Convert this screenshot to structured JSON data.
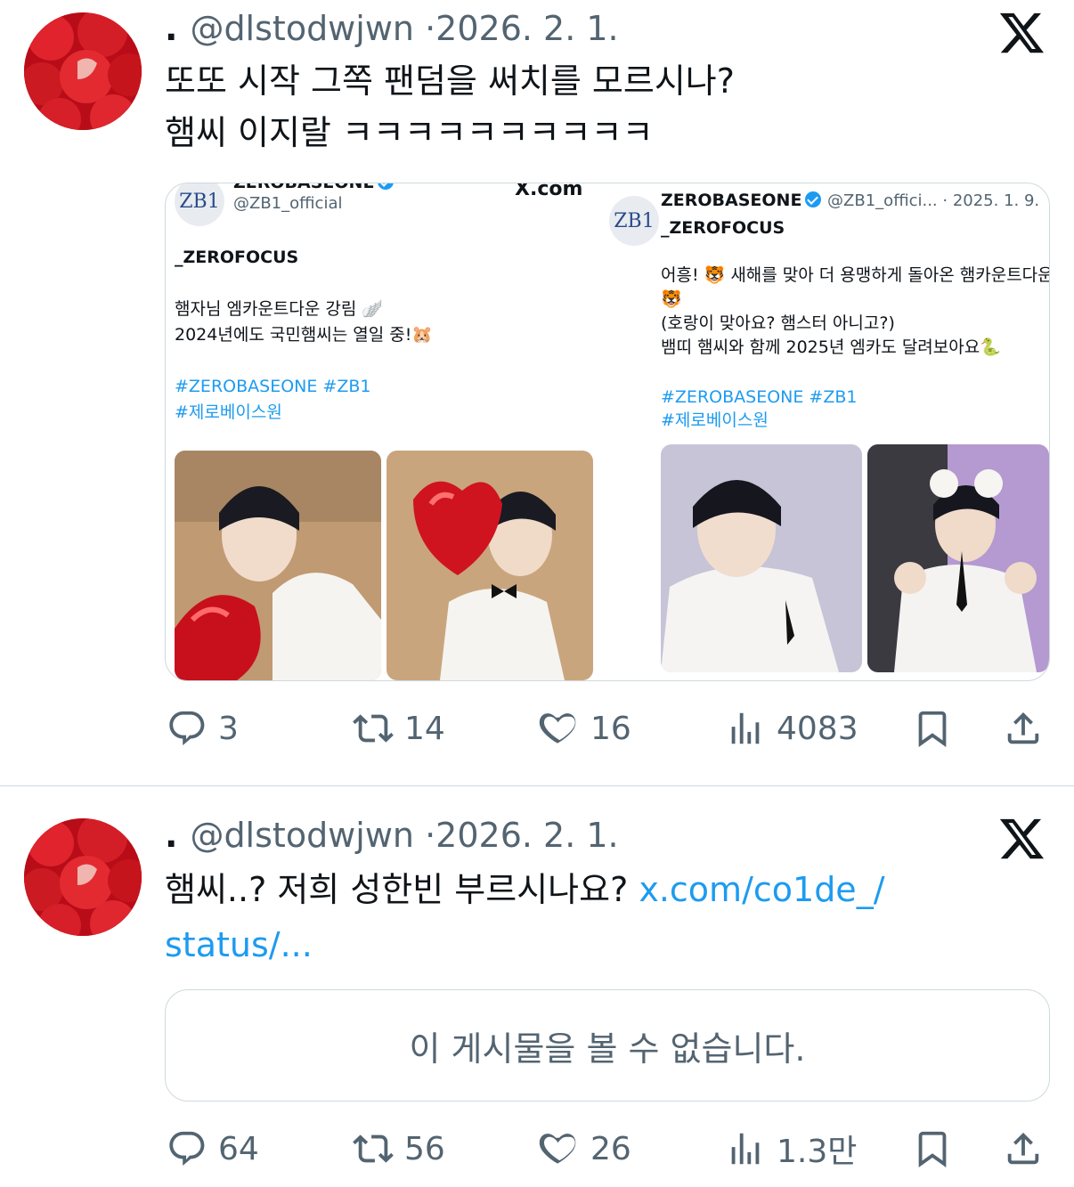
{
  "tweets": [
    {
      "meta_dot": ".",
      "handle": "@dlstodwjwn",
      "separator": "·",
      "date": "2026. 2. 1.",
      "text_line1": "또또 시작 그쪽 팬덤을 써치를 모르시나?",
      "text_line2": "햄씨 이지랄 ㅋㅋㅋㅋㅋㅋㅋㅋㅋㅋ",
      "embed": {
        "left": {
          "logo": "ZB1",
          "name_partial": "ZEROBASEONE",
          "handle": "@ZB1_official",
          "site": "X.com",
          "line1": "_ZEROFOCUS",
          "line2": "햄자님 엠카운트다운 강림 🪽",
          "line3": "2024년에도 국민햄씨는 열일 중!🐹",
          "tag1": "#ZEROBASEONE #ZB1",
          "tag2": "#제로베이스원"
        },
        "right": {
          "logo": "ZB1",
          "name": "ZEROBASEONE",
          "handle_date": "@ZB1_offici... · 2025. 1. 9.",
          "line1": "_ZEROFOCUS",
          "line2": "어흥! 🐯 새해를 맞아 더 용맹하게 돌아온 햄카운트다운",
          "line3": "🐯",
          "line4": "(호랑이 맞아요? 햄스터 아니고?)",
          "line5": "뱀띠 햄씨와 함께 2025년 엠카도 달려보아요🐍",
          "tag1": "#ZEROBASEONE #ZB1",
          "tag2": "#제로베이스원"
        }
      },
      "replies": "3",
      "reposts": "14",
      "likes": "16",
      "views": "4083"
    },
    {
      "meta_dot": ".",
      "handle": "@dlstodwjwn",
      "separator": "·",
      "date": "2026. 2. 1.",
      "text_part1": "햄씨..? 저희 성한빈 부르시나요? ",
      "link_part1": "x.com/co1de_/",
      "link_part2": "status/...",
      "unavailable": "이 게시물을 볼 수 없습니다.",
      "replies": "64",
      "reposts": "56",
      "likes": "26",
      "views": "1.3만"
    }
  ],
  "icons": [
    "x-logo-icon",
    "reply-icon",
    "repost-icon",
    "like-icon",
    "views-icon",
    "bookmark-icon",
    "share-icon"
  ],
  "colors": {
    "link": "#1d9bf0",
    "muted": "#536471",
    "text": "#0f1419",
    "border": "#cfd9de"
  }
}
